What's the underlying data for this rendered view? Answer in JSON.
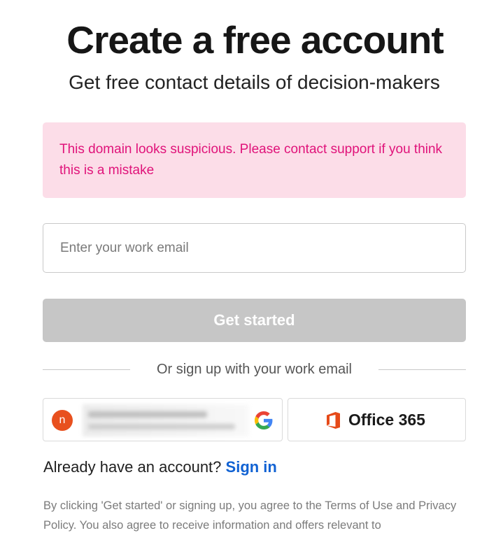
{
  "header": {
    "title": "Create a free account",
    "subtitle": "Get free contact details of decision-makers"
  },
  "alert": {
    "message": "This domain looks suspicious. Please contact support if you think this is a mistake",
    "color": "#e0137a",
    "background": "#fcdde8"
  },
  "form": {
    "email_placeholder": "Enter your work email",
    "email_value": "",
    "submit_label": "Get started",
    "submit_state": "disabled"
  },
  "divider": {
    "text": "Or sign up with your work email"
  },
  "sso": {
    "google": {
      "avatar_initial": "n",
      "avatar_color": "#e8501e",
      "icon": "google-icon"
    },
    "office": {
      "label": "Office 365",
      "icon": "office365-icon"
    }
  },
  "signin": {
    "prompt": "Already have an account?",
    "link_label": "Sign in",
    "link_color": "#1162d3"
  },
  "legal": {
    "text": "By clicking 'Get started' or signing up, you agree to the Terms of Use and Privacy Policy. You also agree to receive information and offers relevant to"
  }
}
